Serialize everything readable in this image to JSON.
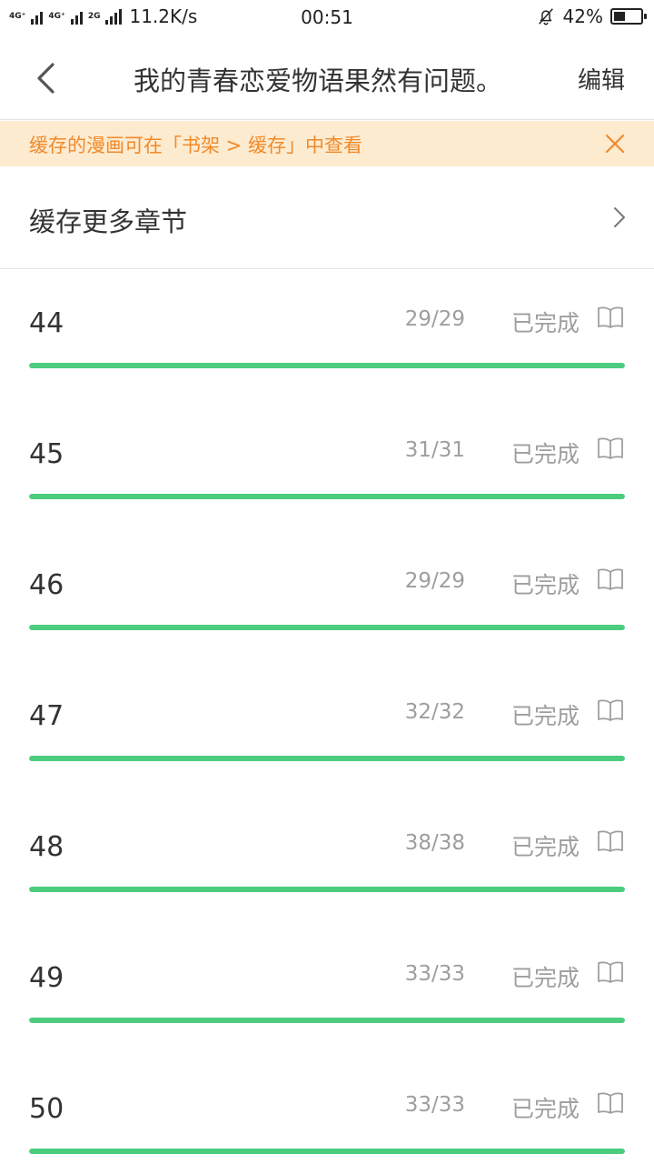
{
  "status_bar": {
    "net1": "4G⁺",
    "net2": "4G⁺",
    "net3": "2G",
    "speed": "11.2K/s",
    "time": "00:51",
    "battery_pct": "42%",
    "battery_level": 0.42
  },
  "header": {
    "title": "我的青春恋爱物语果然有问题。",
    "edit_label": "编辑"
  },
  "notice": {
    "text": "缓存的漫画可在「书架 > 缓存」中查看"
  },
  "cache_more": {
    "label": "缓存更多章节"
  },
  "chapters": [
    {
      "number": "44",
      "pages": "29/29",
      "status": "已完成",
      "progress": 1.0
    },
    {
      "number": "45",
      "pages": "31/31",
      "status": "已完成",
      "progress": 1.0
    },
    {
      "number": "46",
      "pages": "29/29",
      "status": "已完成",
      "progress": 1.0
    },
    {
      "number": "47",
      "pages": "32/32",
      "status": "已完成",
      "progress": 1.0
    },
    {
      "number": "48",
      "pages": "38/38",
      "status": "已完成",
      "progress": 1.0
    },
    {
      "number": "49",
      "pages": "33/33",
      "status": "已完成",
      "progress": 1.0
    },
    {
      "number": "50",
      "pages": "33/33",
      "status": "已完成",
      "progress": 1.0
    }
  ],
  "colors": {
    "accent_green": "#4ccc7e",
    "notice_bg": "#fdebd0",
    "notice_text": "#f08a2a"
  },
  "icons": {
    "back": "chevron-left-icon",
    "close": "close-icon",
    "chevron": "chevron-right-icon",
    "read": "open-book-icon",
    "mute": "bell-off-icon"
  }
}
